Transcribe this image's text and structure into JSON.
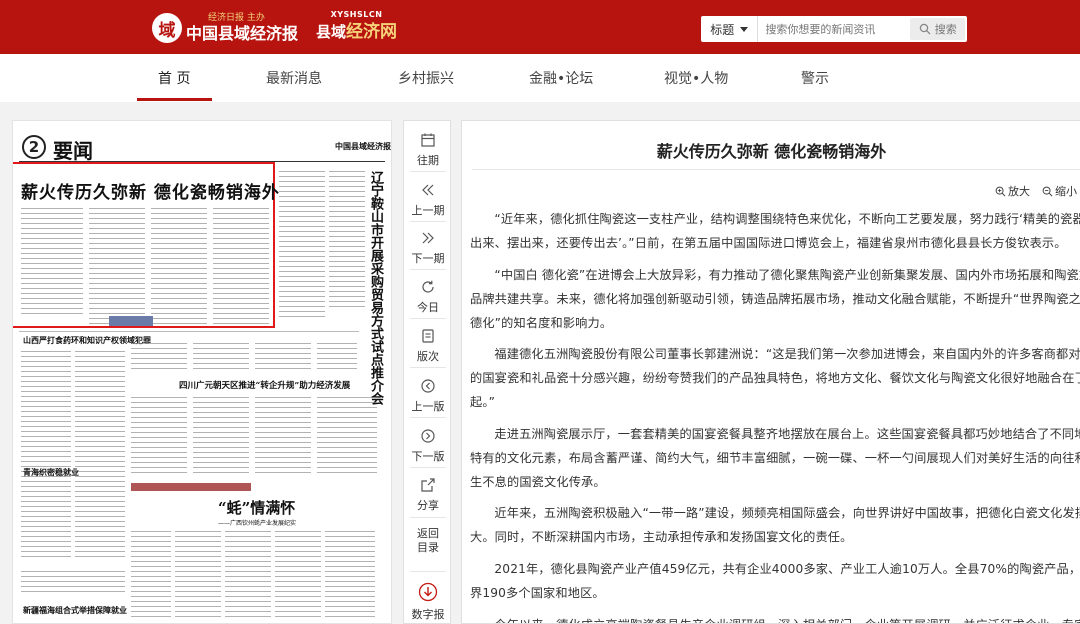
{
  "header": {
    "logo1_top": "经济日报 主办",
    "logo1_main": "中国县域经济报",
    "logo1_emblem": "域",
    "logo2_top": "XYSHSLCN",
    "logo2_main_a": "县域",
    "logo2_main_b": "经济网",
    "search_type": "标题",
    "search_placeholder": "搜索你想要的新闻资讯",
    "search_button": "搜索"
  },
  "nav": {
    "items": [
      {
        "label": "首 页",
        "active": true
      },
      {
        "label": "最新消息"
      },
      {
        "label": "乡村振兴"
      },
      {
        "label": "金融•论坛"
      },
      {
        "label": "视觉•人物"
      },
      {
        "label": "警示"
      }
    ]
  },
  "paper": {
    "page_num": "2",
    "section": "要闻",
    "masthead": "中国县域经济报",
    "headline": "薪火传历久弥新  德化瓷畅销海外",
    "sub_headline_1": "山西严打食药环和知识产权领域犯罪",
    "sub_headline_2": "四川广元朝天区推进“转企升规”助力经济发展",
    "sub_headline_3": "青海织密稳就业",
    "sub_headline_4": "“蚝”情满怀",
    "sub_headline_4_sub": "——广西钦州蚝产业发展纪实",
    "sub_headline_5": "新疆福海组合式举措保障就业",
    "vertical_headline": "辽宁鞍山市开展采购贸易方式试点推介会"
  },
  "tools": {
    "items": [
      {
        "label": "往期",
        "icon": "calendar-icon"
      },
      {
        "label": "上一期",
        "icon": "double-chevron-left-icon"
      },
      {
        "label": "下一期",
        "icon": "double-chevron-right-icon"
      },
      {
        "label": "今日",
        "icon": "refresh-icon"
      },
      {
        "label": "版次",
        "icon": "document-icon"
      },
      {
        "label": "上一版",
        "icon": "circle-arrow-left-icon"
      },
      {
        "label": "下一版",
        "icon": "circle-arrow-right-icon"
      },
      {
        "label": "分享",
        "icon": "share-icon"
      },
      {
        "label": "返回目录",
        "icon": ""
      },
      {
        "label": "数字报",
        "icon": "download-icon"
      }
    ]
  },
  "article": {
    "title": "薪火传历久弥新 德化瓷畅销海外",
    "zoom_in": "放大",
    "zoom_out": "缩小",
    "paragraphs": [
      [
        "“近年来，德化抓住陶瓷这一支柱产业，结构调整围绕特色来优化，不断向工艺要发展，努力践行‘精美的瓷器做",
        "出来、摆出来，还要传出去’。”日前，在第五届中国国际进口博览会上，福建省泉州市德化县县长方俊钦表示。"
      ],
      [
        "“中国白 德化瓷”在进博会上大放异彩，有力推动了德化聚焦陶瓷产业创新集聚发展、国内外市场拓展和陶瓷文化",
        "品牌共建共享。未来，德化将加强创新驱动引领，铸造品牌拓展市场，推动文化融合赋能，不断提升“世界陶瓷之都·",
        "德化”的知名度和影响力。"
      ],
      [
        "福建德化五洲陶瓷股份有限公司董事长郭建洲说：“这是我们第一次参加进博会，来自国内外的许多客商都对我们",
        "的国宴瓷和礼品瓷十分感兴趣，纷纷夸赞我们的产品独具特色，将地方文化、餐饮文化与陶瓷文化很好地融合在了一",
        "起。”"
      ],
      [
        "走进五洲陶瓷展示厅，一套套精美的国宴瓷餐具整齐地摆放在展台上。这些国宴瓷餐具都巧妙地结合了不同地区",
        "特有的文化元素，布局含蓄严谨、简约大气，细节丰富细腻，一碗一碟、一杯一勺间展现人们对美好生活的向往和生",
        "生不息的国瓷文化传承。"
      ],
      [
        "近年来，五洲陶瓷积极融入“一带一路”建设，频频亮相国际盛会，向世界讲好中国故事，把德化白瓷文化发扬光",
        "大。同时，不断深耕国内市场，主动承担传承和发扬国宴文化的责任。"
      ],
      [
        "2021年，德化县陶瓷产业产值459亿元，共有企业4000多家、产业工人逾10万人。全县70%的陶瓷产品，远销世",
        "界190多个国家和地区。"
      ],
      [
        "今年以来，德化成立高端陶瓷餐具生产企业调研组，深入相关部门、企业等开展调研，并广泛征求企业、专家学"
      ]
    ]
  }
}
